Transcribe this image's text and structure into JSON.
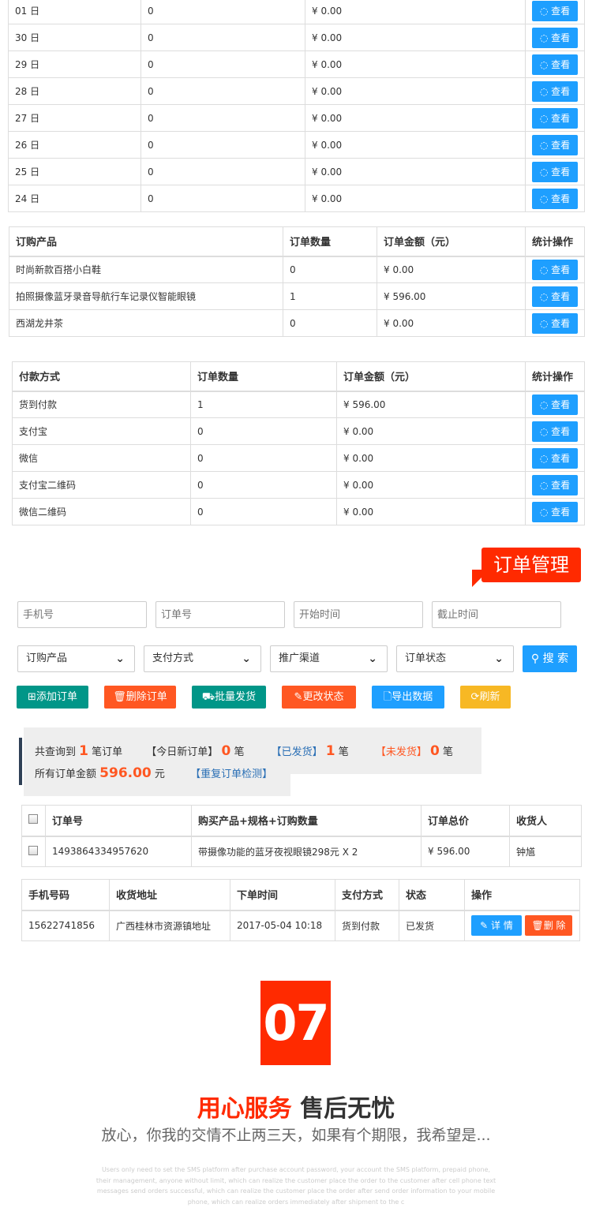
{
  "daily_table": {
    "rows": [
      [
        "01 日",
        "0",
        "¥ 0.00"
      ],
      [
        "30 日",
        "0",
        "¥ 0.00"
      ],
      [
        "29 日",
        "0",
        "¥ 0.00"
      ],
      [
        "28 日",
        "0",
        "¥ 0.00"
      ],
      [
        "27 日",
        "0",
        "¥ 0.00"
      ],
      [
        "26 日",
        "0",
        "¥ 0.00"
      ],
      [
        "25 日",
        "0",
        "¥ 0.00"
      ],
      [
        "24 日",
        "0",
        "¥ 0.00"
      ]
    ]
  },
  "view_label": "查看",
  "product_table": {
    "headers": [
      "订购产品",
      "订单数量",
      "订单金额（元）",
      "统计操作"
    ],
    "rows": [
      [
        "时尚新款百搭小白鞋",
        "0",
        "¥ 0.00"
      ],
      [
        "拍照摄像蓝牙录音导航行车记录仪智能眼镜",
        "1",
        "¥ 596.00"
      ],
      [
        "西湖龙井茶",
        "0",
        "¥ 0.00"
      ]
    ]
  },
  "payment_table": {
    "headers": [
      "付款方式",
      "订单数量",
      "订单金额（元）",
      "统计操作"
    ],
    "rows": [
      [
        "货到付款",
        "1",
        "¥ 596.00"
      ],
      [
        "支付宝",
        "0",
        "¥ 0.00"
      ],
      [
        "微信",
        "0",
        "¥ 0.00"
      ],
      [
        "支付宝二维码",
        "0",
        "¥ 0.00"
      ],
      [
        "微信二维码",
        "0",
        "¥ 0.00"
      ]
    ]
  },
  "section_badge": "订单管理",
  "filters": {
    "phone_placeholder": "手机号",
    "order_placeholder": "订单号",
    "start_placeholder": "开始时间",
    "end_placeholder": "截止时间",
    "selects": [
      "订购产品",
      "支付方式",
      "推广渠道",
      "订单状态"
    ],
    "search_label": "搜 索"
  },
  "toolbar": [
    {
      "label": "添加订单",
      "icon": "plus-square-icon",
      "glyph": "⊞",
      "color": "#009688"
    },
    {
      "label": "删除订单",
      "icon": "trash-icon",
      "glyph": "🗑",
      "color": "#ff5722"
    },
    {
      "label": "批量发货",
      "icon": "truck-icon",
      "glyph": "⛟",
      "color": "#009688"
    },
    {
      "label": "更改状态",
      "icon": "edit-icon",
      "glyph": "✎",
      "color": "#ff5722"
    },
    {
      "label": "导出数据",
      "icon": "file-icon",
      "glyph": "🗋",
      "color": "#1e9fff"
    },
    {
      "label": "刷新",
      "icon": "refresh-icon",
      "glyph": "⟳",
      "color": "#f7b824"
    }
  ],
  "summary": {
    "query_pre": "共查询到",
    "query_count": "1",
    "query_post": "笔订单",
    "today_label": "【今日新订单】",
    "today_count": "0",
    "unit": "笔",
    "shipped_label": "【已发货】",
    "shipped_count": "1",
    "unshipped_label": "【未发货】",
    "unshipped_count": "0",
    "total_label": "所有订单金额",
    "total_amount": "596.00",
    "total_unit": "元",
    "dup_check": "【重复订单检测】"
  },
  "order_table": {
    "headers": [
      "订单号",
      "购买产品+规格+订购数量",
      "订单总价",
      "收货人"
    ],
    "rows": [
      [
        "1493864334957620",
        "带摄像功能的蓝牙夜视眼镜298元 X 2",
        "¥ 596.00",
        "钟馗"
      ]
    ]
  },
  "order_detail_table": {
    "headers": [
      "手机号码",
      "收货地址",
      "下单时间",
      "支付方式",
      "状态",
      "操作"
    ],
    "rows": [
      [
        "15622741856",
        "广西桂林市资源镇地址",
        "2017-05-04 10:18",
        "货到付款",
        "已发货"
      ]
    ],
    "detail_label": "详 情",
    "delete_label": "删 除"
  },
  "promo": {
    "number": "07",
    "title_red": "用心服务",
    "title_dark": "售后无忧",
    "subtitle": "放心，你我的交情不止两三天，如果有个期限，我希望是...",
    "english": "Users only need to set the SMS platform after purchase account password, your account the SMS platform, prepaid phone, their management, anyone without limit, which can realize the customer place the order to the customer after cell phone text messages send orders successful, which can realize the customer place the order after send order information to your mobile phone, which can realize orders immediately after shipment to the c"
  }
}
